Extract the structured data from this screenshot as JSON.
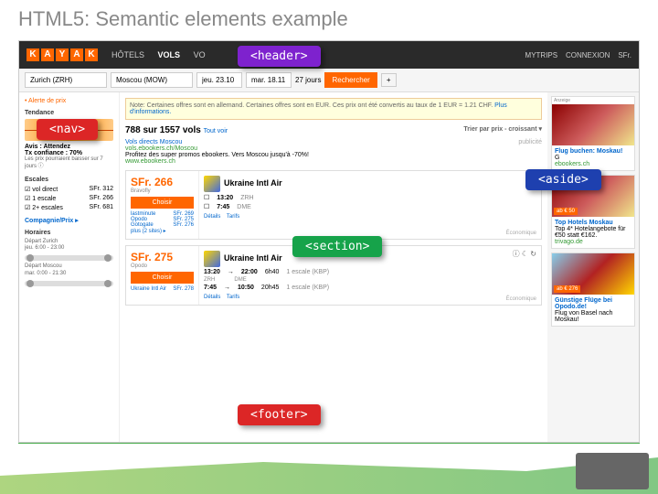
{
  "slide": {
    "title": "HTML5: Semantic elements example"
  },
  "labels": {
    "header": "<header>",
    "nav": "<nav>",
    "section": "<section>",
    "aside": "<aside>",
    "footer": "<footer>"
  },
  "logo": [
    "K",
    "A",
    "Y",
    "A",
    "K"
  ],
  "topnav": {
    "hotels": "HÔTELS",
    "vols": "VOLS",
    "vo": "VO",
    "mytrips": "MYTRIPS",
    "connexion": "CONNEXION",
    "cur": "SFr."
  },
  "search": {
    "from": "Zurich (ZRH)",
    "to": "Moscou (MOW)",
    "d1": "jeu. 23.10",
    "d2": "mar. 18.11",
    "days": "27 jours",
    "btn": "Rechercher",
    "plus": "+"
  },
  "nav": {
    "alert": "• Alerte de prix",
    "trend": "Tendance",
    "advice": "Avis : Attendez",
    "conf": "Tx confiance : 70%",
    "confnote": "Les prix pourraient baisser sur 7 jours ⓘ",
    "escales": "Escales",
    "direct": "vol direct",
    "p1": "SFr. 312",
    "e1": "1 escale",
    "p2": "SFr. 266",
    "e2": "2+ escales",
    "p3": "SFr. 681",
    "comp": "Compagnie/Prix ▸",
    "hor": "Horaires",
    "depz": "Départ Zurich",
    "depzh": "jeu. 6:00 - 23:00",
    "depm": "Départ Moscou",
    "depmh": "mar. 0:00 - 21:30"
  },
  "main": {
    "note": "Note: Certaines offres sont en allemand. Certaines offres sont en EUR. Ces prix ont été convertis au taux de 1 EUR = 1.21 CHF.",
    "notelink": "Plus d'informations.",
    "count": "788 sur 1557 vols",
    "toutvoir": "Tout voir",
    "sort": "Trier par prix - croissant ▾",
    "promo": {
      "t": "Vols directs Moscou",
      "sub": "vols.ebookers.ch/Moscou",
      "txt": "Profitez des super promos ebookers. Vers Moscou jusqu'à -70%!",
      "site": "www.ebookers.ch",
      "pub": "publicité"
    },
    "c1": {
      "price": "SFr. 266",
      "prov": "Bravofly",
      "btn": "Choisir",
      "a1n": "lastminute",
      "a1p": "SFr. 269",
      "a2n": "Opodo",
      "a2p": "SFr. 275",
      "a3n": "Gotogate",
      "a3p": "SFr. 276",
      "more": "plus (2 sites) ▸",
      "airline": "Ukraine Intl Air",
      "t1": "13:20",
      "t1c": "ZRH",
      "t2": "7:45",
      "t2c": "DME",
      "det": "Détails",
      "tar": "Tarifs",
      "econ": "Économique"
    },
    "c2": {
      "price": "SFr. 275",
      "prov": "Opodo",
      "btn": "Choisir",
      "a1n": "Ukraine Intl Air",
      "a1p": "SFr. 278",
      "airline": "Ukraine Intl Air",
      "r1a": "13:20",
      "r1b": "22:00",
      "r1d": "6h40",
      "r1e": "1 escale (KBP)",
      "r1f": "ZRH",
      "r1g": "DME",
      "r2a": "7:45",
      "r2b": "10:50",
      "r2d": "20h45",
      "r2e": "1 escale (KBP)",
      "det": "Détails",
      "tar": "Tarifs",
      "econ": "Économique"
    }
  },
  "ads": {
    "l": "Anzeige",
    "a1": {
      "t": "Flug buchen: Moskau!",
      "s": "G",
      "link": "ebookers.ch"
    },
    "a2": {
      "badge": "ab € 50",
      "t": "Top Hotels Moskau",
      "s": "Top 4* Hotelangebote für €50 statt €162.",
      "link": "trivago.de"
    },
    "a3": {
      "badge": "ab € 276",
      "t": "Günstige Flüge bei Opodo.de!",
      "s": "Flug von Basel nach Moskau!"
    }
  }
}
